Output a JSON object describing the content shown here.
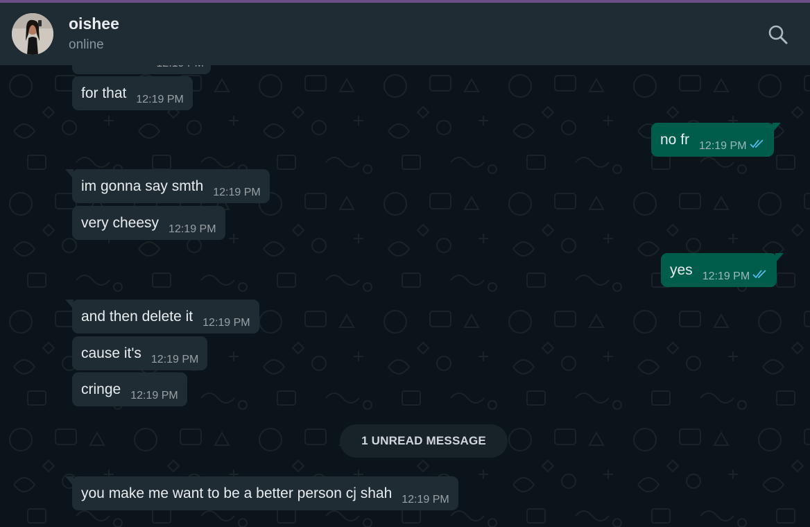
{
  "header": {
    "name": "oishee",
    "status": "online",
    "search_icon": "search-icon"
  },
  "messages": [
    {
      "direction": "in",
      "text": "for that",
      "time": "12:19 PM"
    },
    {
      "direction": "out",
      "text": "no fr",
      "time": "12:19 PM",
      "read": true
    },
    {
      "direction": "in",
      "text": "im gonna say smth",
      "time": "12:19 PM"
    },
    {
      "direction": "in",
      "text": "very cheesy",
      "time": "12:19 PM"
    },
    {
      "direction": "out",
      "text": "yes",
      "time": "12:19 PM",
      "read": true
    },
    {
      "direction": "in",
      "text": "and then delete it",
      "time": "12:19 PM"
    },
    {
      "direction": "in",
      "text": "cause it's",
      "time": "12:19 PM"
    },
    {
      "direction": "in",
      "text": "cringe",
      "time": "12:19 PM"
    },
    {
      "direction": "in",
      "text": "you make me want to be a better person cj shah",
      "time": "12:19 PM"
    }
  ],
  "partial_message_time": "12:19 PM",
  "unread_banner": "1 UNREAD MESSAGE",
  "colors": {
    "background": "#0b141a",
    "header": "#202c33",
    "incoming_bubble": "#202c33",
    "outgoing_bubble": "#005c4b",
    "read_ticks": "#53bdeb",
    "accent_strip": "#6b4f86"
  }
}
